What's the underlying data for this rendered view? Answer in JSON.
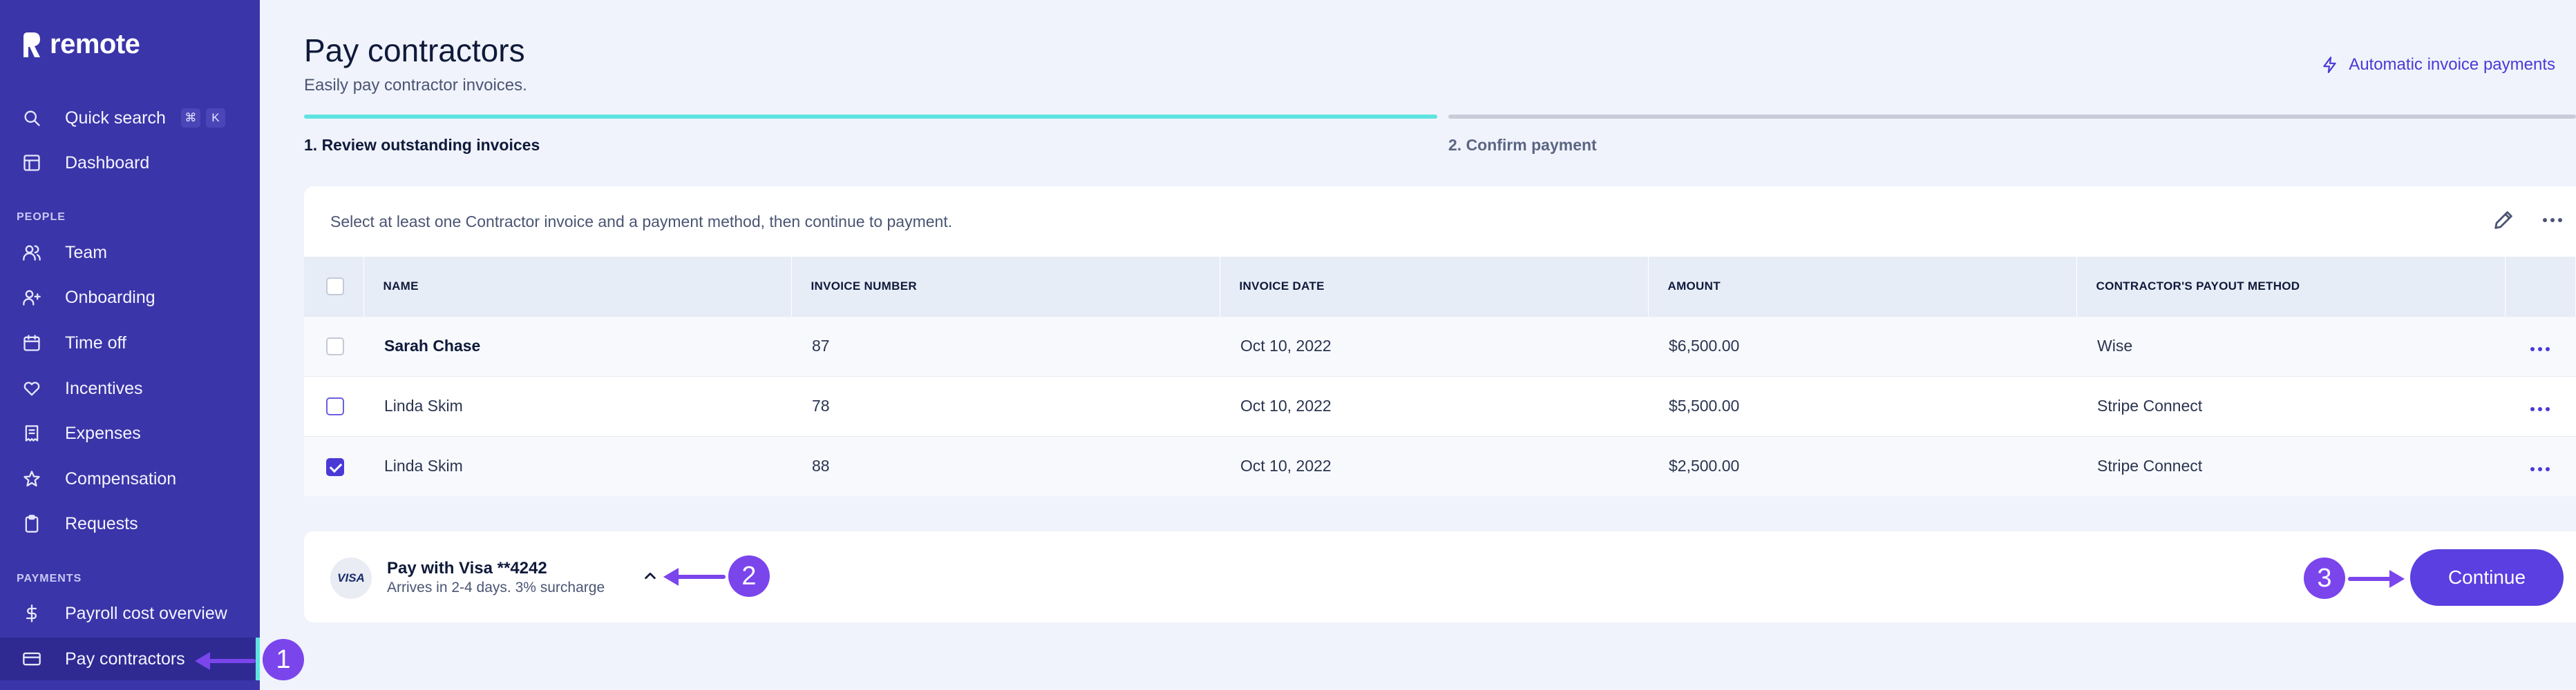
{
  "brand": {
    "name": "remote"
  },
  "sidebar": {
    "quick_search": {
      "label": "Quick search",
      "shortcut_mod": "⌘",
      "shortcut_key": "K"
    },
    "dashboard": "Dashboard",
    "people_section": "PEOPLE",
    "people_items": [
      "Team",
      "Onboarding",
      "Time off",
      "Incentives",
      "Expenses",
      "Compensation",
      "Requests"
    ],
    "payments_section": "PAYMENTS",
    "payments_items": [
      "Payroll cost overview",
      "Pay contractors"
    ]
  },
  "header": {
    "title": "Pay contractors",
    "subtitle": "Easily pay contractor invoices.",
    "auto_link": "Automatic invoice payments"
  },
  "steps": [
    "1. Review outstanding invoices",
    "2. Confirm payment"
  ],
  "table": {
    "instruction": "Select at least one Contractor invoice and a payment method, then continue to payment.",
    "columns": [
      "NAME",
      "INVOICE NUMBER",
      "INVOICE DATE",
      "AMOUNT",
      "CONTRACTOR'S PAYOUT METHOD"
    ],
    "rows": [
      {
        "name": "Sarah Chase",
        "invoice": "87",
        "date": "Oct 10, 2022",
        "amount": "$6,500.00",
        "method": "Wise",
        "checked": false
      },
      {
        "name": "Linda Skim",
        "invoice": "78",
        "date": "Oct 10, 2022",
        "amount": "$5,500.00",
        "method": "Stripe Connect",
        "checked": false
      },
      {
        "name": "Linda Skim",
        "invoice": "88",
        "date": "Oct 10, 2022",
        "amount": "$2,500.00",
        "method": "Stripe Connect",
        "checked": true
      }
    ]
  },
  "payment": {
    "card_brand": "VISA",
    "title": "Pay with Visa **4242",
    "subtitle": "Arrives in 2-4 days. 3% surcharge",
    "continue_label": "Continue"
  },
  "callouts": [
    "1",
    "2",
    "3"
  ],
  "colors": {
    "sidebar": "#3a35a8",
    "accent": "#5b3fe0",
    "progress": "#5fe3e0",
    "callout": "#7b45ec"
  }
}
